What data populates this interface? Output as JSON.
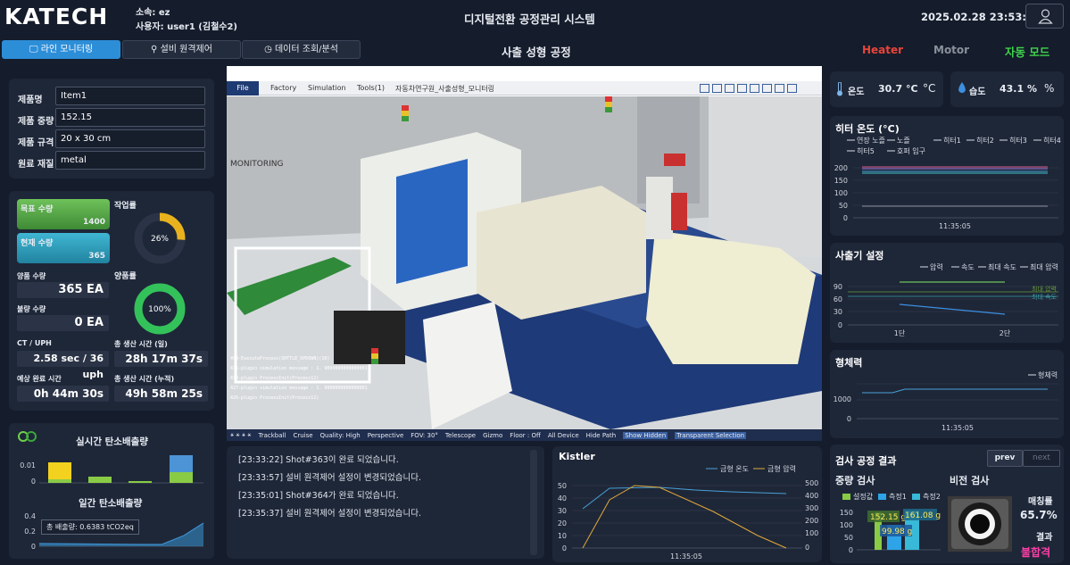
{
  "header": {
    "logo": "KATECH",
    "affiliation": "소속: ez",
    "user": "사용자: user1 (김철수2)",
    "title": "디지털전환 공정관리 시스템",
    "datetime": "2025.02.28 23:53:52"
  },
  "tabs": [
    {
      "label": "라인 모니터링"
    },
    {
      "label": "설비 원격제어"
    },
    {
      "label": "데이터 조회/분석"
    }
  ],
  "process_title": "사출 성형 공정",
  "status": {
    "heater": "Heater",
    "motor": "Motor",
    "mode": "자동 모드",
    "heater_color": "#e8443a",
    "motor_color": "#8a919c",
    "mode_color": "#3ed34a"
  },
  "product": {
    "name_label": "제품명",
    "name": "Item1",
    "weight_label": "제품 중량",
    "weight": "152.15",
    "spec_label": "제품 규격",
    "spec": "20 x 30 cm",
    "material_label": "원료 재질",
    "material": "metal"
  },
  "production": {
    "target_label": "목표 수량",
    "target": "1400",
    "current_label": "현재 수량",
    "current": "365",
    "work_rate_label": "작업률",
    "work_rate": "26%",
    "work_rate_value": 0.26,
    "good_label": "양품 수량",
    "good": "365 EA",
    "bad_label": "불량 수량",
    "bad": "0 EA",
    "yield_label": "양품률",
    "yield": "100%",
    "yield_value": 1.0,
    "ct_label": "CT / UPH",
    "ct": "2.58 sec / 36 uph",
    "total_day_label": "총 생산 시간 (일)",
    "total_day": "28h 17m 37s",
    "expected_label": "예상 완료 시간",
    "expected": "0h 44m 30s",
    "total_cum_label": "총 생산 시간 (누적)",
    "total_cum": "49h 58m 25s"
  },
  "carbon": {
    "realtime_title": "실시간 탄소배출량",
    "daily_title": "일간 탄소배출량",
    "total_tooltip": "총 배출량: 0.6383 tCO2eq",
    "logo": "CO2"
  },
  "viewer": {
    "menu": [
      "File",
      "Factory",
      "Simulation",
      "Tools(1)",
      "자동차연구원_사출성형_모니터링"
    ],
    "monitoring": "MONITORING",
    "bottom": [
      "Trackball",
      "Cruise",
      "Quality: High",
      "Perspective",
      "FOV: 30°",
      "Telescope",
      "Gizmo",
      "Floor : Off",
      "All Device",
      "Hide Path",
      "Show Hidden",
      "Transparent Selection"
    ],
    "console": [
      "494-ExecuteProcess(SHTTLE_UPDOWN)(10)",
      "431-plugin simulation message : 1. 9000000000000001",
      "430-plugin ProcessInit(Process12)",
      "427-plugin simulation message : 1. 9000000000000001",
      "426-plugin ProcessInit(Process12)"
    ]
  },
  "logs": [
    "[23:33:22] Shot#363이 완료 되었습니다.",
    "[23:33:57] 설비 원격제어 설정이 변경되었습니다.",
    "[23:35:01] Shot#364가 완료 되었습니다.",
    "[23:35:37] 설비 원격제어 설정이 변경되었습니다."
  ],
  "kistler": {
    "title": "Kistler",
    "legend": [
      "금형 온도",
      "금형 압력"
    ],
    "left_ticks": [
      "50",
      "40",
      "30",
      "20",
      "10",
      "0"
    ],
    "right_ticks": [
      "500",
      "400",
      "300",
      "200",
      "100",
      "0"
    ],
    "time": "11:35:05"
  },
  "env": {
    "temp_label": "온도",
    "temp": "30.7 °C",
    "temp_unit": "°C",
    "hum_label": "습도",
    "hum": "43.1 %",
    "hum_unit": "%"
  },
  "heater_chart": {
    "title": "히터 온도 (°C)",
    "legend": [
      "연장 노즐",
      "노즐",
      "히터1",
      "히터2",
      "히터3",
      "히터4",
      "히터5",
      "호퍼 입구"
    ],
    "ticks": [
      "200",
      "150",
      "100",
      "50",
      "0"
    ],
    "time": "11:35:05"
  },
  "injection_chart": {
    "title": "사출기 설정",
    "legend": [
      "압력",
      "속도",
      "최대 속도",
      "최대 압력"
    ],
    "ticks": [
      "90",
      "60",
      "30",
      "0"
    ],
    "xlabels": [
      "1단",
      "2단"
    ],
    "annot1": "최대 압력",
    "annot2": "최대 속도"
  },
  "clamp_chart": {
    "title": "형체력",
    "legend": [
      "형체력"
    ],
    "ticks": [
      "1000",
      "0"
    ],
    "time": "11:35:05"
  },
  "inspection": {
    "title": "검사 공정 결과",
    "prev": "prev",
    "next": "next",
    "weight_title": "중량 검사",
    "vision_title": "비전 검사",
    "legend": [
      "설정값",
      "측정1",
      "측정2"
    ],
    "ticks": [
      "150",
      "100",
      "50",
      "0"
    ],
    "v1": "152.15 g",
    "v2": "161.08 g",
    "v3": "99.98 g",
    "match_label": "매칭률",
    "match": "65.7%",
    "result_label": "결과",
    "result": "불합격"
  }
}
